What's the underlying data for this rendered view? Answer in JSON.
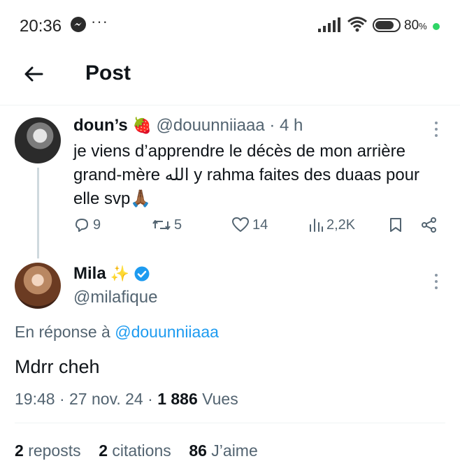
{
  "status_bar": {
    "time": "20:36",
    "battery_percent": "80",
    "battery_unit": "%",
    "messenger_icon": "messenger-icon",
    "overflow": "···"
  },
  "header": {
    "title": "Post",
    "back_icon": "arrow-left-icon"
  },
  "original_tweet": {
    "name": "doun’s",
    "name_emoji": "🍓",
    "handle": "@douunniiaaa",
    "separator": "·",
    "time": "4 h",
    "text": "je viens d’apprendre le décès de mon arrière grand-mère الله y rahma faites des duaas pour elle svp🙏🏾",
    "replies": "9",
    "reposts": "5",
    "likes": "14",
    "views": "2,2K"
  },
  "reply_tweet": {
    "name": "Mila",
    "name_emoji": "✨",
    "handle": "@milafique",
    "reply_label": "En réponse à",
    "reply_handle": "@douunniiaaa",
    "text": "Mdrr cheh",
    "time": "19:48",
    "date": "27 nov. 24",
    "views_count": "1 886",
    "views_label": "Vues",
    "dot": "·"
  },
  "stats": {
    "reposts_count": "2",
    "reposts_label": "reposts",
    "citations_count": "2",
    "citations_label": "citations",
    "likes_count": "86",
    "likes_label": "J’aime"
  },
  "colors": {
    "accent": "#1d9bf0",
    "secondary_text": "#536471",
    "primary_text": "#0f1419"
  }
}
